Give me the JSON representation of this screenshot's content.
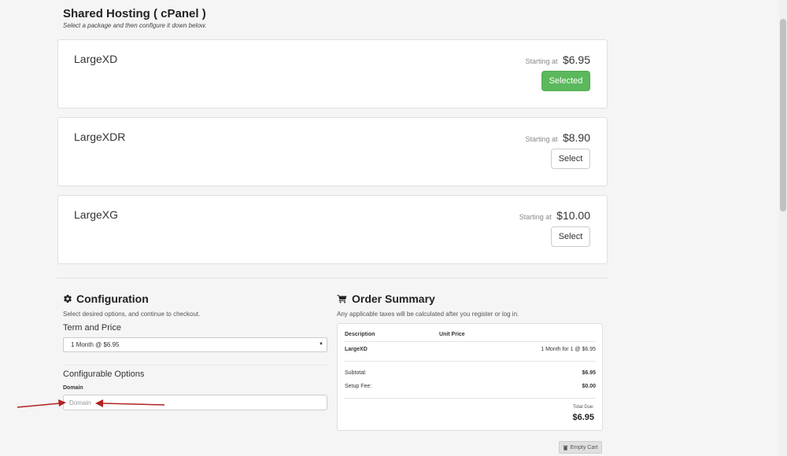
{
  "header": {
    "title": "Shared Hosting ( cPanel )",
    "subtitle": "Select a package and then configure it down below."
  },
  "packages": [
    {
      "name": "LargeXD",
      "starting_label": "Starting at",
      "price": "$6.95",
      "button": "Selected",
      "selected": true
    },
    {
      "name": "LargeXDR",
      "starting_label": "Starting at",
      "price": "$8.90",
      "button": "Select",
      "selected": false
    },
    {
      "name": "LargeXG",
      "starting_label": "Starting at",
      "price": "$10.00",
      "button": "Select",
      "selected": false
    }
  ],
  "configuration": {
    "icon": "gear-icon",
    "title": "Configuration",
    "subtitle": "Select desired options, and continue to checkout.",
    "term_label": "Term and Price",
    "term_value": "1 Month @ $6.95",
    "options_title": "Configurable Options",
    "domain_label": "Domain",
    "domain_placeholder": "Domain"
  },
  "order_summary": {
    "icon": "cart-icon",
    "title": "Order Summary",
    "subtitle": "Any applicable taxes will be calculated after you register or log in.",
    "col_description": "Description",
    "col_unit_price": "Unit Price",
    "item_name": "LargeXD",
    "item_detail": "1 Month for 1 @ $6.95",
    "subtotal_label": "Subtotal:",
    "subtotal_value": "$6.95",
    "setup_label": "Setup Fee:",
    "setup_value": "$0.00",
    "total_label": "Total Due:",
    "total_value": "$6.95"
  },
  "empty_cart": {
    "icon": "trash-icon",
    "label": "Empty Cart"
  },
  "colors": {
    "selected": "#5cb85c",
    "annotation_arrow": "#b22222"
  }
}
